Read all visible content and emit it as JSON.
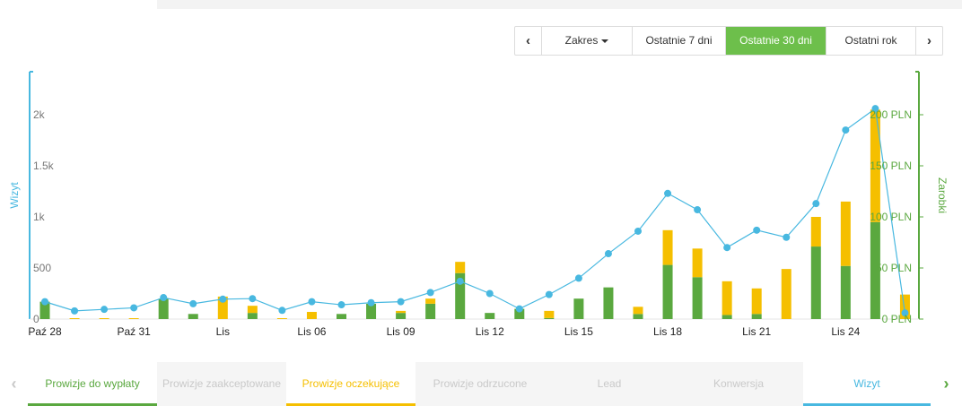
{
  "range_nav": {
    "prev_label": "‹",
    "zakres_label": "Zakres",
    "ranges": [
      "Ostatnie 7 dni",
      "Ostatnie 30 dni",
      "Ostatni rok"
    ],
    "active_range": "Ostatnie 30 dni",
    "next_label": "›"
  },
  "tabs": {
    "left_arrow": "‹",
    "items": [
      {
        "label": "Prowizje do wypłaty",
        "color": "#5aa83f",
        "underline": "#5aa83f"
      },
      {
        "label": "Prowizje zaakceptowane",
        "color": "#c9c9c9",
        "underline": ""
      },
      {
        "label": "Prowizje oczekujące",
        "color": "#f5bf00",
        "underline": "#f5bf00"
      },
      {
        "label": "Prowizje odrzucone",
        "color": "#c9c9c9",
        "underline": ""
      },
      {
        "label": "Lead",
        "color": "#c9c9c9",
        "underline": ""
      },
      {
        "label": "Konwersja",
        "color": "#c9c9c9",
        "underline": ""
      },
      {
        "label": "Wizyt",
        "color": "#48b8e0",
        "underline": "#48b8e0"
      }
    ],
    "right_arrow": "›"
  },
  "chart_data": {
    "type": "bar",
    "ylabel": "Wizyt",
    "y2label": "Zarobki",
    "ylim": [
      0,
      2000
    ],
    "y2lim": [
      0,
      200
    ],
    "y_ticks": [
      "0",
      "500",
      "1k",
      "1.5k",
      "2k"
    ],
    "y2_ticks": [
      "0 PLN",
      "50 PLN",
      "100 PLN",
      "150 PLN",
      "200 PLN"
    ],
    "x_tick_labels": [
      "Paź 28",
      "Paź 31",
      "Lis",
      "Lis 06",
      "Lis 09",
      "Lis 12",
      "Lis 15",
      "Lis 18",
      "Lis 21",
      "Lis 24"
    ],
    "colors": {
      "visits": "#48b8e0",
      "payout": "#5aa83f",
      "pending": "#f5bf00",
      "left_axis": "#48b8e0",
      "right_axis": "#5aa83f"
    },
    "series": [
      {
        "name": "Prowizje do wypłaty",
        "type": "bar",
        "stack": "earnings",
        "values": [
          17,
          0,
          0,
          0,
          20,
          5,
          0,
          6,
          0,
          0,
          5,
          15,
          6,
          15,
          45,
          6,
          10,
          1,
          20,
          31,
          5,
          53,
          41,
          4,
          5,
          0,
          71,
          52,
          95,
          0
        ]
      },
      {
        "name": "Prowizje oczekujące",
        "type": "bar",
        "stack": "earnings",
        "values": [
          0,
          0,
          0,
          0,
          0,
          0,
          22,
          7,
          0,
          7,
          0,
          0,
          2,
          5,
          11,
          0,
          0,
          7,
          0,
          0,
          7,
          34,
          28,
          33,
          25,
          49,
          29,
          63,
          110,
          24
        ]
      },
      {
        "name": "Wizyt",
        "type": "line",
        "values": [
          170,
          80,
          95,
          110,
          210,
          150,
          195,
          200,
          85,
          170,
          140,
          160,
          170,
          260,
          370,
          250,
          100,
          240,
          400,
          640,
          860,
          1230,
          1070,
          700,
          870,
          800,
          1130,
          1850,
          2060,
          60
        ]
      }
    ]
  }
}
